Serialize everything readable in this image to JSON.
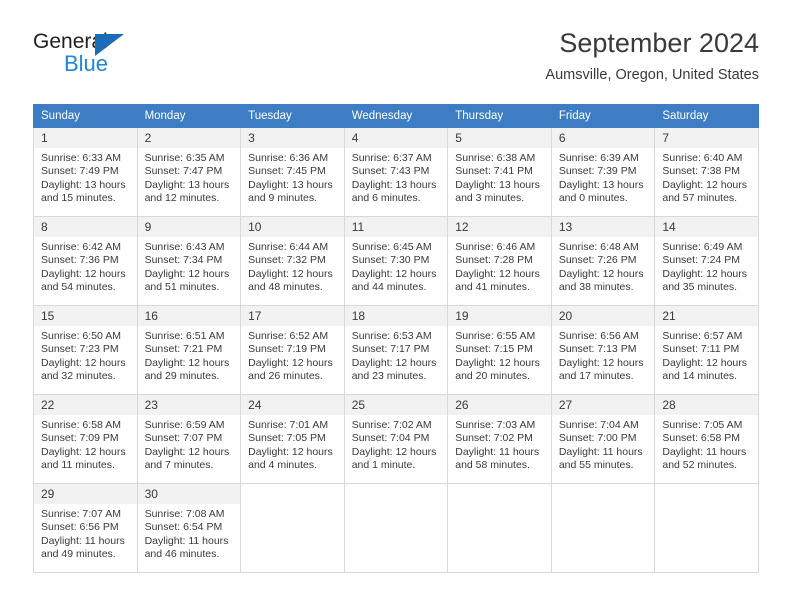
{
  "logo": {
    "word_dark": "General",
    "word_blue": "Blue",
    "triangle_color": "#1a6db5",
    "blue_color": "#1e87d6"
  },
  "header": {
    "title": "September 2024",
    "subtitle": "Aumsville, Oregon, United States",
    "header_bg": "#3c7dc4",
    "daynum_bg": "#f2f2f2"
  },
  "weekdays": [
    "Sunday",
    "Monday",
    "Tuesday",
    "Wednesday",
    "Thursday",
    "Friday",
    "Saturday"
  ],
  "weeks": [
    [
      {
        "day": "1",
        "sunrise": "Sunrise: 6:33 AM",
        "sunset": "Sunset: 7:49 PM",
        "daylight": "Daylight: 13 hours and 15 minutes."
      },
      {
        "day": "2",
        "sunrise": "Sunrise: 6:35 AM",
        "sunset": "Sunset: 7:47 PM",
        "daylight": "Daylight: 13 hours and 12 minutes."
      },
      {
        "day": "3",
        "sunrise": "Sunrise: 6:36 AM",
        "sunset": "Sunset: 7:45 PM",
        "daylight": "Daylight: 13 hours and 9 minutes."
      },
      {
        "day": "4",
        "sunrise": "Sunrise: 6:37 AM",
        "sunset": "Sunset: 7:43 PM",
        "daylight": "Daylight: 13 hours and 6 minutes."
      },
      {
        "day": "5",
        "sunrise": "Sunrise: 6:38 AM",
        "sunset": "Sunset: 7:41 PM",
        "daylight": "Daylight: 13 hours and 3 minutes."
      },
      {
        "day": "6",
        "sunrise": "Sunrise: 6:39 AM",
        "sunset": "Sunset: 7:39 PM",
        "daylight": "Daylight: 13 hours and 0 minutes."
      },
      {
        "day": "7",
        "sunrise": "Sunrise: 6:40 AM",
        "sunset": "Sunset: 7:38 PM",
        "daylight": "Daylight: 12 hours and 57 minutes."
      }
    ],
    [
      {
        "day": "8",
        "sunrise": "Sunrise: 6:42 AM",
        "sunset": "Sunset: 7:36 PM",
        "daylight": "Daylight: 12 hours and 54 minutes."
      },
      {
        "day": "9",
        "sunrise": "Sunrise: 6:43 AM",
        "sunset": "Sunset: 7:34 PM",
        "daylight": "Daylight: 12 hours and 51 minutes."
      },
      {
        "day": "10",
        "sunrise": "Sunrise: 6:44 AM",
        "sunset": "Sunset: 7:32 PM",
        "daylight": "Daylight: 12 hours and 48 minutes."
      },
      {
        "day": "11",
        "sunrise": "Sunrise: 6:45 AM",
        "sunset": "Sunset: 7:30 PM",
        "daylight": "Daylight: 12 hours and 44 minutes."
      },
      {
        "day": "12",
        "sunrise": "Sunrise: 6:46 AM",
        "sunset": "Sunset: 7:28 PM",
        "daylight": "Daylight: 12 hours and 41 minutes."
      },
      {
        "day": "13",
        "sunrise": "Sunrise: 6:48 AM",
        "sunset": "Sunset: 7:26 PM",
        "daylight": "Daylight: 12 hours and 38 minutes."
      },
      {
        "day": "14",
        "sunrise": "Sunrise: 6:49 AM",
        "sunset": "Sunset: 7:24 PM",
        "daylight": "Daylight: 12 hours and 35 minutes."
      }
    ],
    [
      {
        "day": "15",
        "sunrise": "Sunrise: 6:50 AM",
        "sunset": "Sunset: 7:23 PM",
        "daylight": "Daylight: 12 hours and 32 minutes."
      },
      {
        "day": "16",
        "sunrise": "Sunrise: 6:51 AM",
        "sunset": "Sunset: 7:21 PM",
        "daylight": "Daylight: 12 hours and 29 minutes."
      },
      {
        "day": "17",
        "sunrise": "Sunrise: 6:52 AM",
        "sunset": "Sunset: 7:19 PM",
        "daylight": "Daylight: 12 hours and 26 minutes."
      },
      {
        "day": "18",
        "sunrise": "Sunrise: 6:53 AM",
        "sunset": "Sunset: 7:17 PM",
        "daylight": "Daylight: 12 hours and 23 minutes."
      },
      {
        "day": "19",
        "sunrise": "Sunrise: 6:55 AM",
        "sunset": "Sunset: 7:15 PM",
        "daylight": "Daylight: 12 hours and 20 minutes."
      },
      {
        "day": "20",
        "sunrise": "Sunrise: 6:56 AM",
        "sunset": "Sunset: 7:13 PM",
        "daylight": "Daylight: 12 hours and 17 minutes."
      },
      {
        "day": "21",
        "sunrise": "Sunrise: 6:57 AM",
        "sunset": "Sunset: 7:11 PM",
        "daylight": "Daylight: 12 hours and 14 minutes."
      }
    ],
    [
      {
        "day": "22",
        "sunrise": "Sunrise: 6:58 AM",
        "sunset": "Sunset: 7:09 PM",
        "daylight": "Daylight: 12 hours and 11 minutes."
      },
      {
        "day": "23",
        "sunrise": "Sunrise: 6:59 AM",
        "sunset": "Sunset: 7:07 PM",
        "daylight": "Daylight: 12 hours and 7 minutes."
      },
      {
        "day": "24",
        "sunrise": "Sunrise: 7:01 AM",
        "sunset": "Sunset: 7:05 PM",
        "daylight": "Daylight: 12 hours and 4 minutes."
      },
      {
        "day": "25",
        "sunrise": "Sunrise: 7:02 AM",
        "sunset": "Sunset: 7:04 PM",
        "daylight": "Daylight: 12 hours and 1 minute."
      },
      {
        "day": "26",
        "sunrise": "Sunrise: 7:03 AM",
        "sunset": "Sunset: 7:02 PM",
        "daylight": "Daylight: 11 hours and 58 minutes."
      },
      {
        "day": "27",
        "sunrise": "Sunrise: 7:04 AM",
        "sunset": "Sunset: 7:00 PM",
        "daylight": "Daylight: 11 hours and 55 minutes."
      },
      {
        "day": "28",
        "sunrise": "Sunrise: 7:05 AM",
        "sunset": "Sunset: 6:58 PM",
        "daylight": "Daylight: 11 hours and 52 minutes."
      }
    ],
    [
      {
        "day": "29",
        "sunrise": "Sunrise: 7:07 AM",
        "sunset": "Sunset: 6:56 PM",
        "daylight": "Daylight: 11 hours and 49 minutes."
      },
      {
        "day": "30",
        "sunrise": "Sunrise: 7:08 AM",
        "sunset": "Sunset: 6:54 PM",
        "daylight": "Daylight: 11 hours and 46 minutes."
      },
      {
        "day": "",
        "sunrise": "",
        "sunset": "",
        "daylight": ""
      },
      {
        "day": "",
        "sunrise": "",
        "sunset": "",
        "daylight": ""
      },
      {
        "day": "",
        "sunrise": "",
        "sunset": "",
        "daylight": ""
      },
      {
        "day": "",
        "sunrise": "",
        "sunset": "",
        "daylight": ""
      },
      {
        "day": "",
        "sunrise": "",
        "sunset": "",
        "daylight": ""
      }
    ]
  ]
}
